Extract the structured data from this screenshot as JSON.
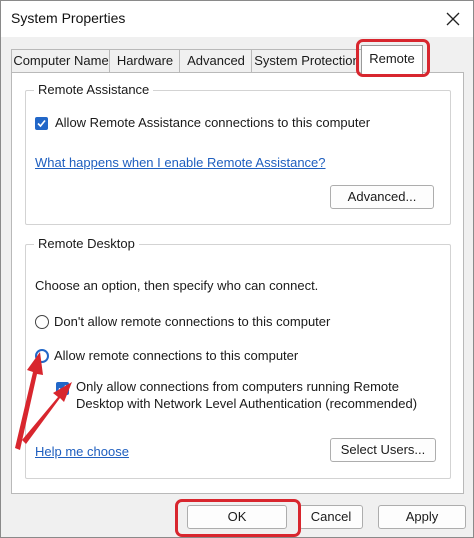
{
  "window": {
    "title": "System Properties"
  },
  "tabs": [
    {
      "label": "Computer Name"
    },
    {
      "label": "Hardware"
    },
    {
      "label": "Advanced"
    },
    {
      "label": "System Protection"
    },
    {
      "label": "Remote"
    }
  ],
  "remote_assistance": {
    "legend": "Remote Assistance",
    "allow_label": "Allow Remote Assistance connections to this computer",
    "allow_checked": true,
    "help_link": "What happens when I enable Remote Assistance?",
    "advanced_button": "Advanced..."
  },
  "remote_desktop": {
    "legend": "Remote Desktop",
    "instruction": "Choose an option, then specify who can connect.",
    "option_dont_allow": "Don't allow remote connections to this computer",
    "option_allow": "Allow remote connections to this computer",
    "selected_option": "allow",
    "nla_label_line1": "Only allow connections from computers running Remote",
    "nla_label_line2": "Desktop with Network Level Authentication (recommended)",
    "nla_checked": true,
    "help_link": "Help me choose",
    "select_users_button": "Select Users..."
  },
  "buttons": {
    "ok": "OK",
    "cancel": "Cancel",
    "apply": "Apply"
  },
  "colors": {
    "accent": "#2267c8",
    "highlight": "#d8262e",
    "link": "#1f5fbf"
  }
}
